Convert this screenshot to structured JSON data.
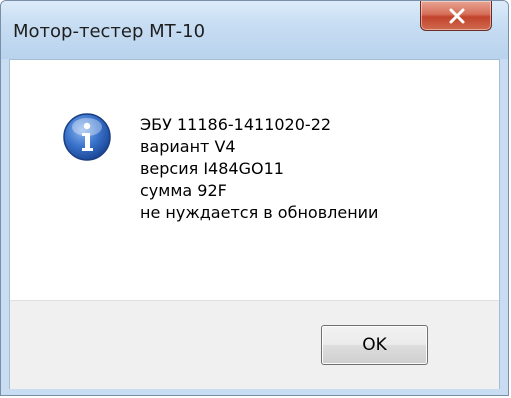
{
  "window": {
    "title": "Мотор-тестер МТ-10"
  },
  "icons": {
    "close": "close-icon",
    "info": "info-icon"
  },
  "message": {
    "lines": [
      "ЭБУ 11186-1411020-22",
      "вариант V4",
      "версия I484GO11",
      "сумма 92F",
      "не нуждается в обновлении"
    ]
  },
  "buttons": {
    "ok_label": "OK"
  },
  "colors": {
    "titlebar": "#c6dcf2",
    "close_button": "#c2432c",
    "info_icon": "#2a63b8"
  }
}
